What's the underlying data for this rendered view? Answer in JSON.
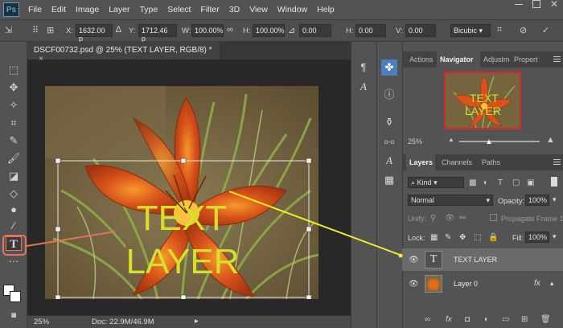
{
  "app": {
    "logo": "Ps"
  },
  "menu": [
    "File",
    "Edit",
    "Image",
    "Layer",
    "Type",
    "Select",
    "Filter",
    "3D",
    "View",
    "Window",
    "Help"
  ],
  "options": {
    "x_label": "X:",
    "x_value": "1632.00 p",
    "y_label": "Y:",
    "y_value": "1712.46 p",
    "w_label": "W:",
    "w_value": "100.00%",
    "h_label": "H:",
    "h_value": "100.00%",
    "angle_value": "0.00",
    "hskew_label": "H:",
    "hskew_value": "0.00",
    "vskew_label": "V:",
    "vskew_value": "0.00",
    "interpolation": "Bicubic"
  },
  "document": {
    "tab_title": "DSCF00732.psd @ 25% (TEXT LAYER, RGB/8) *",
    "tab_close": "×",
    "canvas_text_line1": "TEXT",
    "canvas_text_line2": "LAYER",
    "zoom": "25%",
    "doc_info": "Doc: 22.9M/46.9M"
  },
  "panels": {
    "top_tabs": [
      "Actions",
      "Navigator",
      "Adjustm",
      "Propert"
    ],
    "navigator_zoom": "25%",
    "navigator_thumb_text1": "TEXT",
    "navigator_thumb_text2": "LAYER",
    "layer_tabs": [
      "Layers",
      "Channels",
      "Paths"
    ],
    "kind_filter": "Kind",
    "blend_mode": "Normal",
    "opacity_label": "Opacity:",
    "opacity_value": "100%",
    "unify_label": "Unify:",
    "propagate_label": "Propagate Frame 1",
    "lock_label": "Lock:",
    "fill_label": "Fill:",
    "fill_value": "100%",
    "layers": [
      {
        "name": "TEXT LAYER",
        "thumb": "T"
      },
      {
        "name": "Layer 0",
        "fx": "fx"
      }
    ]
  },
  "colors": {
    "accent_red": "#d9262c",
    "annotation_yellow": "#f2ee2c",
    "text_layer_yellow": "#d6e02a",
    "selection_blue": "#31a8ff"
  }
}
